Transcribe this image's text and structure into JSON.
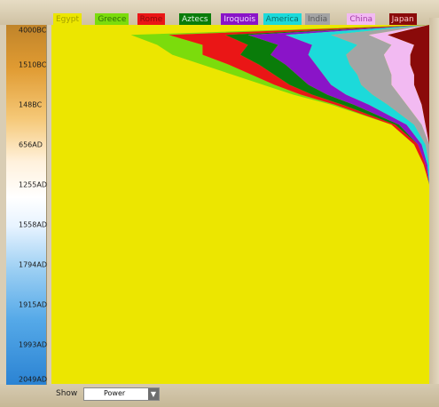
{
  "legend": [
    {
      "label": "Egypt",
      "bg": "#ece600",
      "fg": "#a5a000"
    },
    {
      "label": "Greece",
      "bg": "#7bdc0c",
      "fg": "#2f6f08"
    },
    {
      "label": "Rome",
      "bg": "#ea1616",
      "fg": "#8c0a0a"
    },
    {
      "label": "Aztecs",
      "bg": "#0a7c0a",
      "fg": "#ddf4dd"
    },
    {
      "label": "Iroquois",
      "bg": "#8a14c8",
      "fg": "#efdcff"
    },
    {
      "label": "America",
      "bg": "#1cdada",
      "fg": "#0a6d6d"
    },
    {
      "label": "India",
      "bg": "#a4a4a4",
      "fg": "#5a5a5a"
    },
    {
      "label": "China",
      "bg": "#f2baf2",
      "fg": "#a43da4"
    },
    {
      "label": "Japan",
      "bg": "#8a0a0a",
      "fg": "#ffcaca"
    }
  ],
  "time_axis": [
    "4000BC",
    "1510BC",
    "148BC",
    "656AD",
    "1255AD",
    "1558AD",
    "1794AD",
    "1915AD",
    "1993AD",
    "2049AD"
  ],
  "show": {
    "label": "Show",
    "value": "Power"
  },
  "chart_data": {
    "type": "area",
    "orientation": "vertical-time",
    "title": "",
    "time_ticks": [
      "4000BC",
      "1510BC",
      "148BC",
      "656AD",
      "1255AD",
      "1558AD",
      "1794AD",
      "1915AD",
      "1993AD",
      "2049AD"
    ],
    "metric": "Power",
    "stacked_percent": true,
    "colors": [
      "#ece600",
      "#7bdc0c",
      "#ea1616",
      "#0a7c0a",
      "#8a14c8",
      "#1cdada",
      "#a4a4a4",
      "#f2baf2",
      "#8a0a0a"
    ],
    "t": [
      0,
      0.25,
      0.5,
      0.75,
      1,
      1.25,
      1.5,
      1.75,
      2,
      2.5,
      3,
      3.5,
      4,
      5,
      6,
      9
    ],
    "shares": [
      [
        1.0,
        0,
        0,
        0,
        0,
        0,
        0,
        0,
        0
      ],
      [
        0.21,
        0.1,
        0.15,
        0.06,
        0.1,
        0.12,
        0.1,
        0.05,
        0.11
      ],
      [
        0.28,
        0.12,
        0.12,
        0.08,
        0.09,
        0.12,
        0.09,
        0.06,
        0.04
      ],
      [
        0.32,
        0.08,
        0.1,
        0.08,
        0.1,
        0.1,
        0.1,
        0.07,
        0.05
      ],
      [
        0.4,
        0.07,
        0.08,
        0.07,
        0.08,
        0.09,
        0.1,
        0.06,
        0.05
      ],
      [
        0.48,
        0.05,
        0.06,
        0.06,
        0.07,
        0.09,
        0.09,
        0.06,
        0.04
      ],
      [
        0.56,
        0.03,
        0.04,
        0.05,
        0.06,
        0.08,
        0.08,
        0.06,
        0.04
      ],
      [
        0.64,
        0.02,
        0.03,
        0.04,
        0.05,
        0.07,
        0.07,
        0.05,
        0.03
      ],
      [
        0.74,
        0.01,
        0.02,
        0.03,
        0.04,
        0.05,
        0.05,
        0.04,
        0.02
      ],
      [
        0.9,
        0.0,
        0.01,
        0.01,
        0.02,
        0.02,
        0.02,
        0.01,
        0.01
      ],
      [
        0.96,
        0.0,
        0.01,
        0.0,
        0.01,
        0.01,
        0.01,
        0.0,
        0.0
      ],
      [
        0.985,
        0,
        0.005,
        0,
        0.005,
        0.005,
        0,
        0,
        0
      ],
      [
        1.0,
        0,
        0,
        0,
        0,
        0,
        0,
        0,
        0
      ],
      [
        1.0,
        0,
        0,
        0,
        0,
        0,
        0,
        0,
        0
      ],
      [
        1.0,
        0,
        0,
        0,
        0,
        0,
        0,
        0,
        0
      ],
      [
        1.0,
        0,
        0,
        0,
        0,
        0,
        0,
        0,
        0
      ]
    ]
  }
}
